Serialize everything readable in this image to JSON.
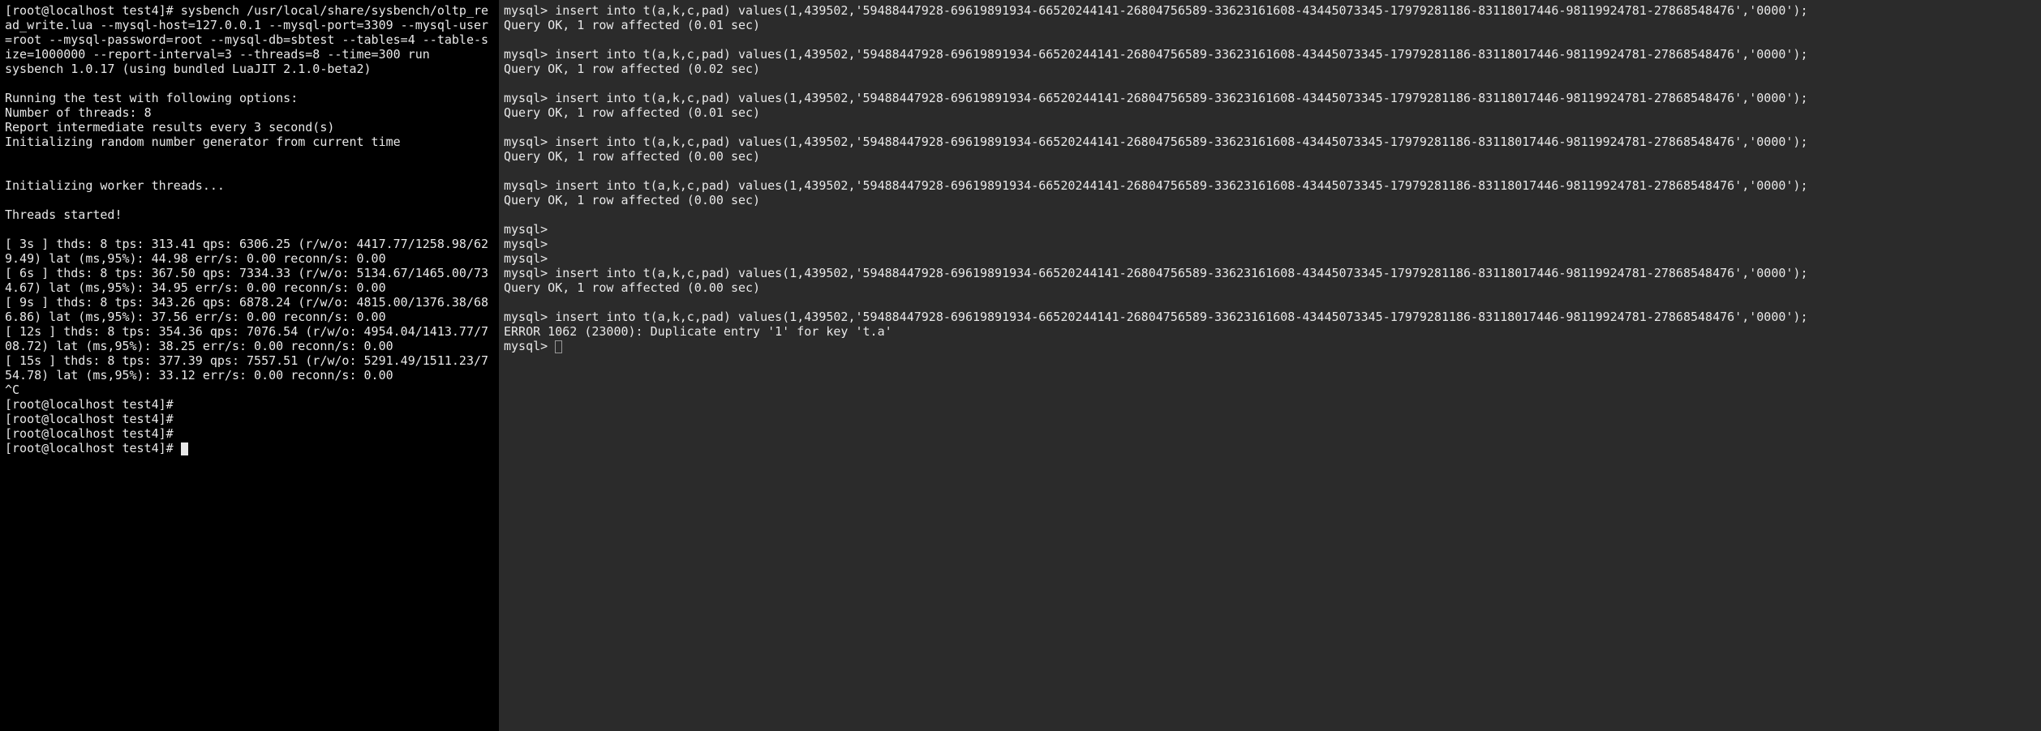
{
  "left": {
    "prompt1": "[root@localhost test4]# sysbench /usr/local/share/sysbench/oltp_read_write.lua --mysql-host=127.0.0.1 --mysql-port=3309 --mysql-user=root --mysql-password=root --mysql-db=sbtest --tables=4 --table-size=1000000 --report-interval=3 --threads=8 --time=300 run",
    "banner": "sysbench 1.0.17 (using bundled LuaJIT 2.1.0-beta2)",
    "opts_header": "Running the test with following options:",
    "opts_threads": "Number of threads: 8",
    "opts_report": "Report intermediate results every 3 second(s)",
    "opts_rng": "Initializing random number generator from current time",
    "init_workers": "Initializing worker threads...",
    "threads_started": "Threads started!",
    "r1": "[ 3s ] thds: 8 tps: 313.41 qps: 6306.25 (r/w/o: 4417.77/1258.98/629.49) lat (ms,95%): 44.98 err/s: 0.00 reconn/s: 0.00",
    "r2": "[ 6s ] thds: 8 tps: 367.50 qps: 7334.33 (r/w/o: 5134.67/1465.00/734.67) lat (ms,95%): 34.95 err/s: 0.00 reconn/s: 0.00",
    "r3": "[ 9s ] thds: 8 tps: 343.26 qps: 6878.24 (r/w/o: 4815.00/1376.38/686.86) lat (ms,95%): 37.56 err/s: 0.00 reconn/s: 0.00",
    "r4": "[ 12s ] thds: 8 tps: 354.36 qps: 7076.54 (r/w/o: 4954.04/1413.77/708.72) lat (ms,95%): 38.25 err/s: 0.00 reconn/s: 0.00",
    "r5": "[ 15s ] thds: 8 tps: 377.39 qps: 7557.51 (r/w/o: 5291.49/1511.23/754.78) lat (ms,95%): 33.12 err/s: 0.00 reconn/s: 0.00",
    "ctrlc": "^C",
    "p2": "[root@localhost test4]#",
    "p3": "[root@localhost test4]#",
    "p4": "[root@localhost test4]#",
    "p5": "[root@localhost test4]# "
  },
  "right": {
    "ins1": "mysql> insert into t(a,k,c,pad) values(1,439502,'59488447928-69619891934-66520244141-26804756589-33623161608-43445073345-17979281186-83118017446-98119924781-27868548476','0000');",
    "ok1": "Query OK, 1 row affected (0.01 sec)",
    "ins2": "mysql> insert into t(a,k,c,pad) values(1,439502,'59488447928-69619891934-66520244141-26804756589-33623161608-43445073345-17979281186-83118017446-98119924781-27868548476','0000');",
    "ok2": "Query OK, 1 row affected (0.02 sec)",
    "ins3": "mysql> insert into t(a,k,c,pad) values(1,439502,'59488447928-69619891934-66520244141-26804756589-33623161608-43445073345-17979281186-83118017446-98119924781-27868548476','0000');",
    "ok3": "Query OK, 1 row affected (0.01 sec)",
    "ins4": "mysql> insert into t(a,k,c,pad) values(1,439502,'59488447928-69619891934-66520244141-26804756589-33623161608-43445073345-17979281186-83118017446-98119924781-27868548476','0000');",
    "ok4": "Query OK, 1 row affected (0.00 sec)",
    "ins5": "mysql> insert into t(a,k,c,pad) values(1,439502,'59488447928-69619891934-66520244141-26804756589-33623161608-43445073345-17979281186-83118017446-98119924781-27868548476','0000');",
    "ok5": "Query OK, 1 row affected (0.00 sec)",
    "pempty1": "mysql>",
    "pempty2": "mysql>",
    "pempty3": "mysql>",
    "ins6": "mysql> insert into t(a,k,c,pad) values(1,439502,'59488447928-69619891934-66520244141-26804756589-33623161608-43445073345-17979281186-83118017446-98119924781-27868548476','0000');",
    "ok6": "Query OK, 1 row affected (0.00 sec)",
    "ins7": "mysql> insert into t(a,k,c,pad) values(1,439502,'59488447928-69619891934-66520244141-26804756589-33623161608-43445073345-17979281186-83118017446-98119924781-27868548476','0000');",
    "err7": "ERROR 1062 (23000): Duplicate entry '1' for key 't.a'",
    "pfinal": "mysql> "
  }
}
